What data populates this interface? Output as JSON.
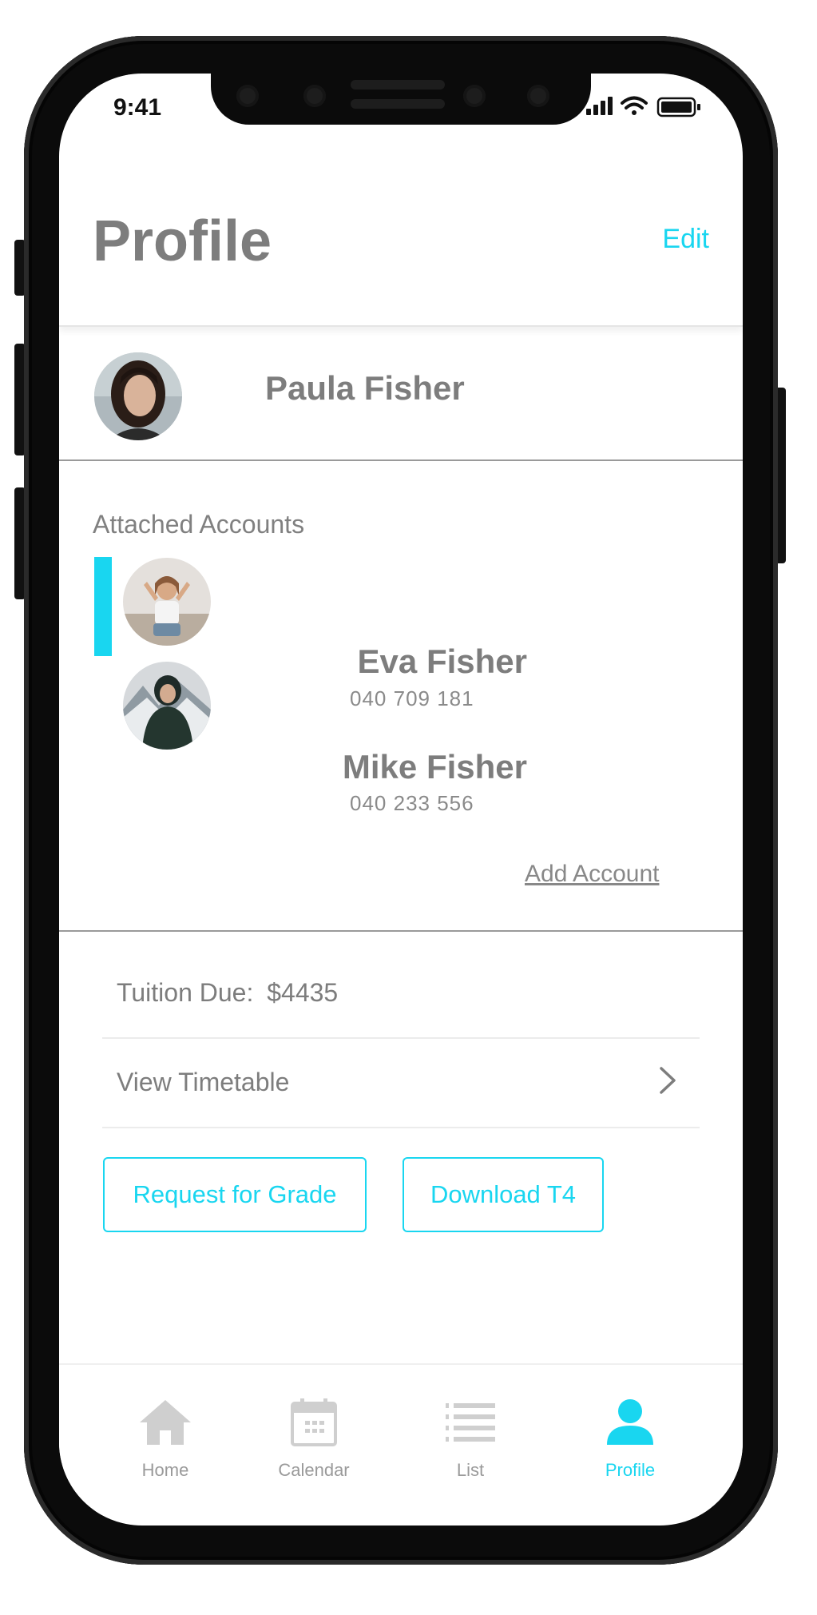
{
  "status_bar": {
    "time": "9:41"
  },
  "header": {
    "title": "Profile",
    "edit_label": "Edit"
  },
  "user": {
    "name": "Paula Fisher"
  },
  "attached_accounts": {
    "label": "Attached Accounts",
    "accounts": [
      {
        "name": "Eva Fisher",
        "phone": "040 709 181",
        "selected": true
      },
      {
        "name": "Mike Fisher",
        "phone": "040 233 556",
        "selected": false
      }
    ],
    "add_label": "Add Account"
  },
  "details": {
    "tuition_label": "Tuition Due:",
    "tuition_value": "$4435",
    "timetable_label": "View Timetable"
  },
  "actions": {
    "request_grade_label": "Request for Grade",
    "download_t4_label": "Download T4"
  },
  "tabbar": {
    "tabs": [
      {
        "label": "Home",
        "icon": "home-icon",
        "active": false
      },
      {
        "label": "Calendar",
        "icon": "calendar-icon",
        "active": false
      },
      {
        "label": "List",
        "icon": "list-icon",
        "active": false
      },
      {
        "label": "Profile",
        "icon": "person-icon",
        "active": true
      }
    ]
  },
  "colors": {
    "accent": "#19d6f0",
    "text_gray": "#7d7d7d",
    "inactive_tab": "#cfcfcf"
  }
}
